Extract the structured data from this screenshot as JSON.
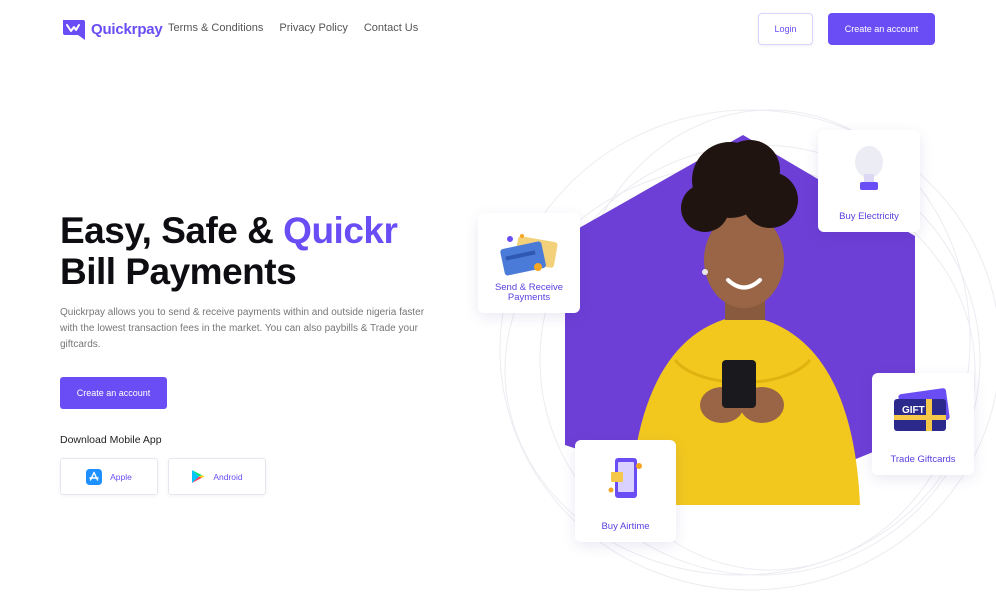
{
  "brand": {
    "name": "Quickrpay"
  },
  "nav": {
    "links": [
      "Terms & Conditions",
      "Privacy Policy",
      "Contact Us"
    ],
    "login_label": "Login",
    "create_label": "Create an account"
  },
  "hero": {
    "title_part1": "Easy, Safe & ",
    "title_accent": "Quickr",
    "title_line2": "Bill Payments",
    "description": "Quickrpay allows you to send & receive payments within and outside nigeria faster with the lowest transaction fees in the market. You can also paybills & Trade your giftcards.",
    "cta_label": "Create an account",
    "download_label": "Download Mobile App",
    "stores": [
      {
        "label": "Apple",
        "icon": "app-store-icon"
      },
      {
        "label": "Android",
        "icon": "google-play-icon"
      }
    ]
  },
  "features": {
    "send_receive_line1": "Send & Receive",
    "send_receive_line2": "Payments",
    "electricity": "Buy Electricity",
    "airtime": "Buy Airtime",
    "giftcards": "Trade Giftcards",
    "gift_tag": "GIFT"
  },
  "colors": {
    "accent": "#6a4df4",
    "hexagon": "#6d3fd6",
    "sweater": "#f2c81f"
  }
}
